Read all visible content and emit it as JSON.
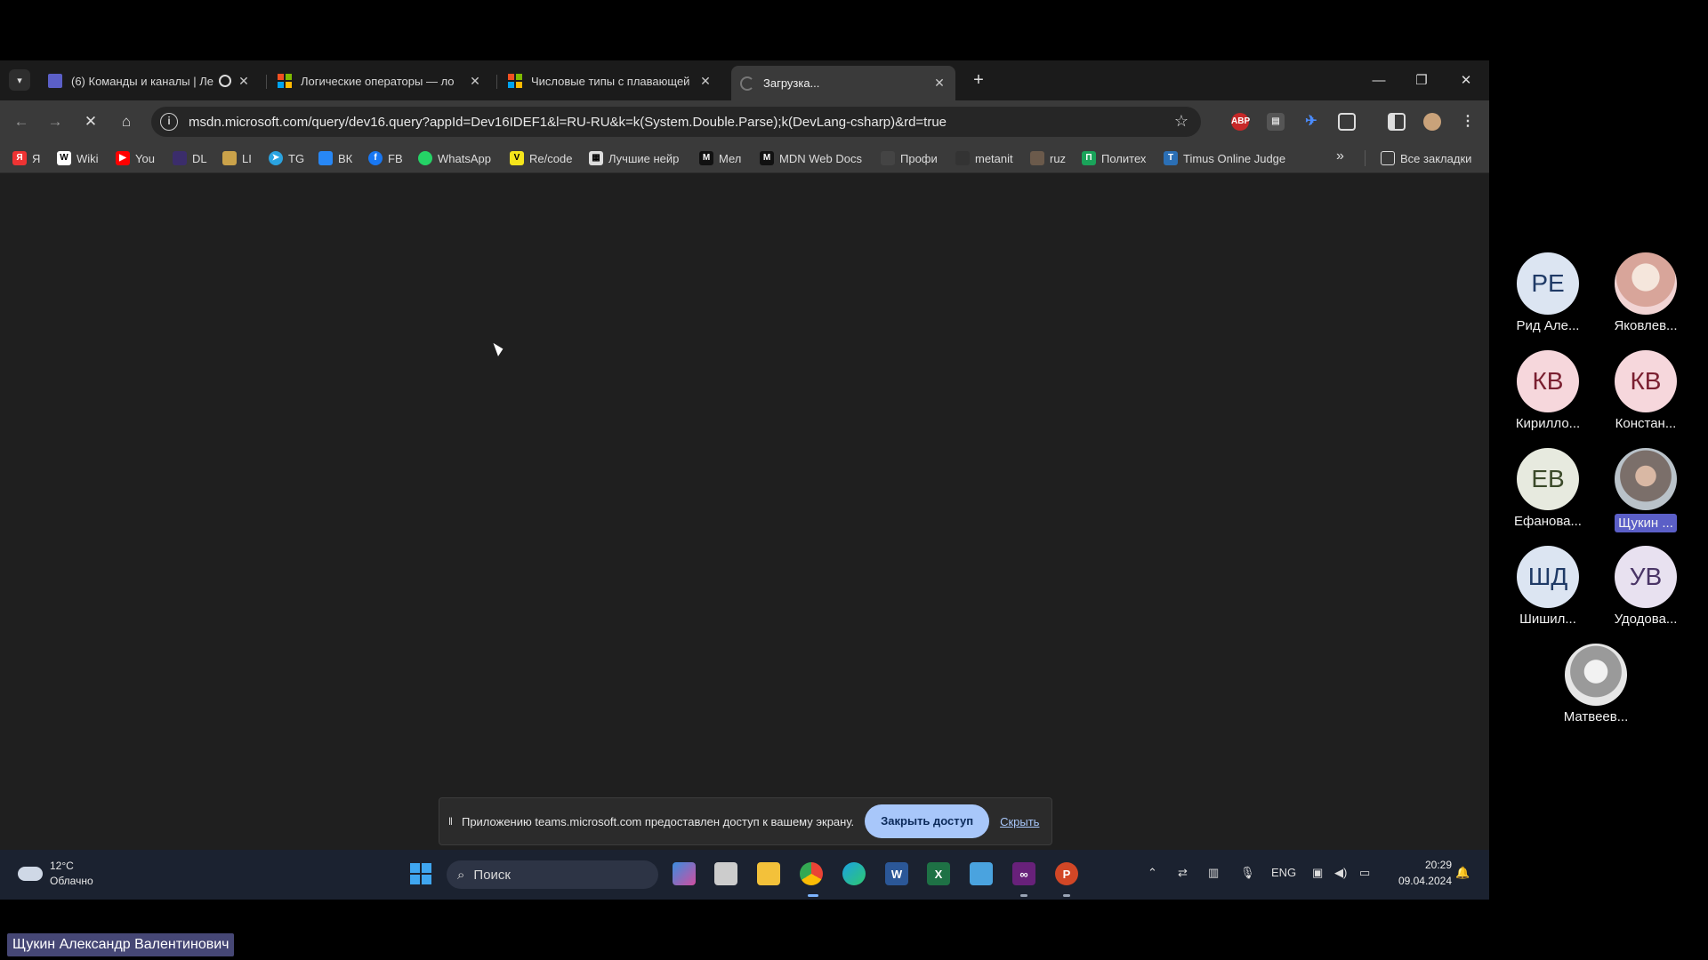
{
  "browser": {
    "tabs": [
      {
        "title": "(6) Команды и каналы | Ле",
        "favicon": "teams-icon",
        "recording": true,
        "active": false
      },
      {
        "title": "Логические операторы — ло",
        "favicon": "microsoft-icon",
        "active": false
      },
      {
        "title": "Числовые типы с плавающей",
        "favicon": "microsoft-icon",
        "active": false
      },
      {
        "title": "Загрузка...",
        "favicon": "loading-icon",
        "active": true
      }
    ],
    "url": "msdn.microsoft.com/query/dev16.query?appId=Dev16IDEF1&l=RU-RU&k=k(System.Double.Parse);k(DevLang-csharp)&rd=true",
    "bookmarks": [
      {
        "label": "Я",
        "color": "#e33"
      },
      {
        "label": "Wiki",
        "color": "#fff"
      },
      {
        "label": "You",
        "color": "#f00"
      },
      {
        "label": "DL",
        "color": "#3b2d6b"
      },
      {
        "label": "LI",
        "color": "#caa24a"
      },
      {
        "label": "TG",
        "color": "#2aa3e0"
      },
      {
        "label": "ВК",
        "color": "#2787f5"
      },
      {
        "label": "FB",
        "color": "#1877f2"
      },
      {
        "label": "WhatsApp",
        "color": "#25d366"
      },
      {
        "label": "Re/code",
        "color": "#f5e51b"
      },
      {
        "label": "Лучшие нейр",
        "color": "#ddd"
      },
      {
        "label": "Мел",
        "color": "#111"
      },
      {
        "label": "MDN Web Docs",
        "color": "#111"
      },
      {
        "label": "Профи",
        "color": "#444"
      },
      {
        "label": "metanit",
        "color": "#333"
      },
      {
        "label": "ruz",
        "color": "#6b5a4b"
      },
      {
        "label": "Политех",
        "color": "#1aa35a"
      },
      {
        "label": "Timus Online Judge",
        "color": "#2b6fb5"
      }
    ],
    "all_bookmarks_label": "Все закладки"
  },
  "share_bar": {
    "message": "Приложению teams.microsoft.com предоставлен доступ к вашему экрану.",
    "stop_label": "Закрыть доступ",
    "hide_label": "Скрыть"
  },
  "taskbar": {
    "temperature": "12°C",
    "condition": "Облачно",
    "search_placeholder": "Поиск",
    "language": "ENG",
    "time": "20:29",
    "date": "09.04.2024"
  },
  "participants": [
    {
      "initials": "РЕ",
      "name": "Рид Але...",
      "bg": "#dce5f2",
      "fg": "#1f3a66"
    },
    {
      "initials": "",
      "name": "Яковлев...",
      "bg": "#f1d4d4",
      "fg": "#000",
      "photo": true
    },
    {
      "initials": "КВ",
      "name": "Кирилло...",
      "bg": "#f6d7dc",
      "fg": "#7a1f30"
    },
    {
      "initials": "КВ",
      "name": "Констан...",
      "bg": "#f6d7dc",
      "fg": "#7a1f30"
    },
    {
      "initials": "ЕВ",
      "name": "Ефанова...",
      "bg": "#e7eadf",
      "fg": "#3b4a2a"
    },
    {
      "initials": "",
      "name": "Щукин ...",
      "bg": "#c9c2bd",
      "fg": "#000",
      "photo": true,
      "highlight": true
    },
    {
      "initials": "ШД",
      "name": "Шишил...",
      "bg": "#dce5f2",
      "fg": "#1f3a66"
    },
    {
      "initials": "УВ",
      "name": "Удодова...",
      "bg": "#e8e1f0",
      "fg": "#4a3566"
    },
    {
      "initials": "",
      "name": "Матвеев...",
      "bg": "#ddd",
      "fg": "#000",
      "photo": true
    }
  ],
  "presenter_name": "Щукин Александр Валентинович"
}
